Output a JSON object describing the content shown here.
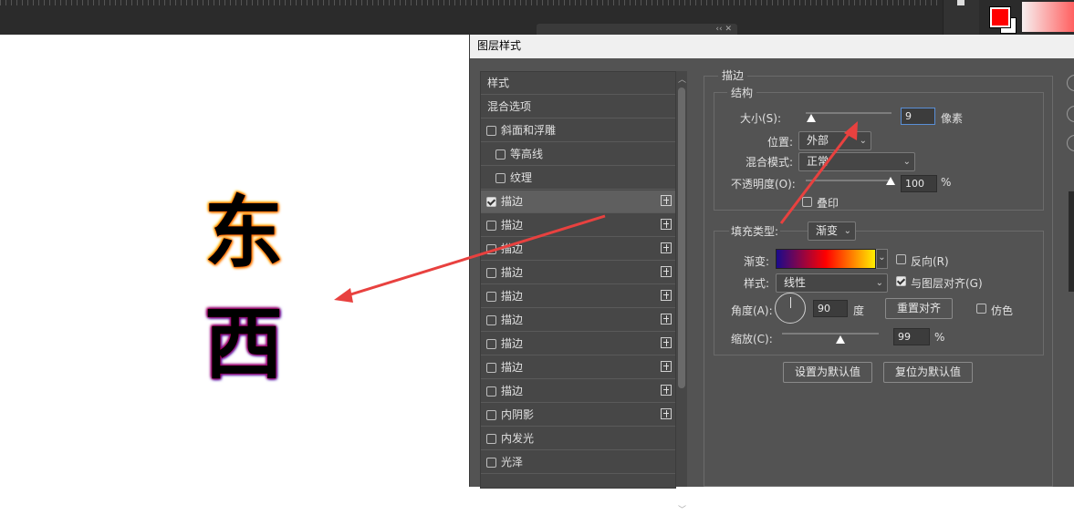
{
  "dialog": {
    "title": "图层样式"
  },
  "style_list": [
    {
      "label": "样式",
      "checkbox": false,
      "indent": 0
    },
    {
      "label": "混合选项",
      "checkbox": false,
      "indent": 0
    },
    {
      "label": "斜面和浮雕",
      "checkbox": true,
      "checked": false,
      "indent": 0
    },
    {
      "label": "等高线",
      "checkbox": true,
      "checked": false,
      "indent": 1
    },
    {
      "label": "纹理",
      "checkbox": true,
      "checked": false,
      "indent": 1
    },
    {
      "label": "描边",
      "checkbox": true,
      "checked": true,
      "plus": true,
      "selected": true,
      "indent": 0
    },
    {
      "label": "描边",
      "checkbox": true,
      "checked": false,
      "plus": true,
      "indent": 0
    },
    {
      "label": "描边",
      "checkbox": true,
      "checked": false,
      "plus": true,
      "indent": 0
    },
    {
      "label": "描边",
      "checkbox": true,
      "checked": false,
      "plus": true,
      "indent": 0
    },
    {
      "label": "描边",
      "checkbox": true,
      "checked": false,
      "plus": true,
      "indent": 0
    },
    {
      "label": "描边",
      "checkbox": true,
      "checked": false,
      "plus": true,
      "indent": 0
    },
    {
      "label": "描边",
      "checkbox": true,
      "checked": false,
      "plus": true,
      "indent": 0
    },
    {
      "label": "描边",
      "checkbox": true,
      "checked": false,
      "plus": true,
      "indent": 0
    },
    {
      "label": "描边",
      "checkbox": true,
      "checked": false,
      "plus": true,
      "indent": 0
    },
    {
      "label": "内阴影",
      "checkbox": true,
      "checked": false,
      "plus": true,
      "indent": 0
    },
    {
      "label": "内发光",
      "checkbox": true,
      "checked": false,
      "indent": 0
    },
    {
      "label": "光泽",
      "checkbox": true,
      "checked": false,
      "indent": 0
    }
  ],
  "stroke": {
    "group_title": "描边",
    "structure_title": "结构",
    "size_label": "大小(S):",
    "size_value": "9",
    "size_unit": "像素",
    "position_label": "位置:",
    "position_value": "外部",
    "blend_label": "混合模式:",
    "blend_value": "正常",
    "opacity_label": "不透明度(O):",
    "opacity_value": "100",
    "opacity_unit": "%",
    "overprint_label": "叠印",
    "overprint_checked": false,
    "fill_type_label": "填充类型:",
    "fill_type_value": "渐变",
    "gradient_label": "渐变:",
    "reverse_label": "反向(R)",
    "reverse_checked": false,
    "style_label": "样式:",
    "style_value": "线性",
    "align_label": "与图层对齐(G)",
    "align_checked": true,
    "angle_label": "角度(A):",
    "angle_value": "90",
    "angle_unit": "度",
    "reset_align_label": "重置对齐",
    "dither_label": "仿色",
    "dither_checked": false,
    "scale_label": "缩放(C):",
    "scale_value": "99",
    "scale_unit": "%",
    "set_default_label": "设置为默认值",
    "reset_default_label": "复位为默认值"
  },
  "canvas": {
    "char1": "东",
    "char2": "西"
  },
  "colors": {
    "foreground": "#ff0000",
    "gradient_stops": [
      "#1a0a8c",
      "#ff0000",
      "#ffee00"
    ],
    "annotation_arrow": "#e8413f"
  }
}
